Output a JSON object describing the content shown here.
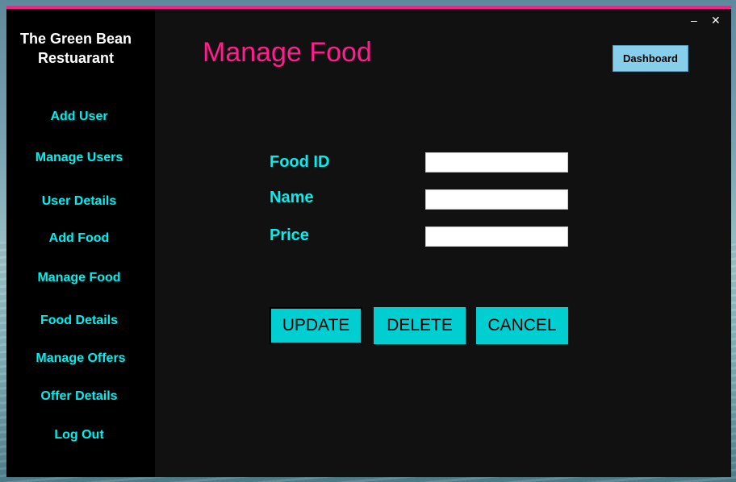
{
  "app": {
    "brand": "The Green Bean Restuarant",
    "minimize_glyph": "–",
    "close_glyph": "✕"
  },
  "sidebar": {
    "items": [
      {
        "label": "Add User"
      },
      {
        "label": "Manage Users"
      },
      {
        "label": "User Details"
      },
      {
        "label": "Add Food"
      },
      {
        "label": "Manage Food"
      },
      {
        "label": "Food Details"
      },
      {
        "label": "Manage Offers"
      },
      {
        "label": "Offer Details"
      },
      {
        "label": "Log Out"
      }
    ]
  },
  "header": {
    "title": "Manage Food",
    "dashboard_label": "Dashboard"
  },
  "form": {
    "food_id": {
      "label": "Food ID",
      "value": ""
    },
    "name": {
      "label": "Name",
      "value": ""
    },
    "price": {
      "label": "Price",
      "value": ""
    }
  },
  "actions": {
    "update_label": "UPDATE",
    "delete_label": "DELETE",
    "cancel_label": "CANCEL"
  },
  "colors": {
    "accent_pink": "#ff1e8c",
    "nav_cyan": "#00f0f0",
    "button_teal": "#00ced1",
    "dashboard_blue": "#87ceeb"
  }
}
